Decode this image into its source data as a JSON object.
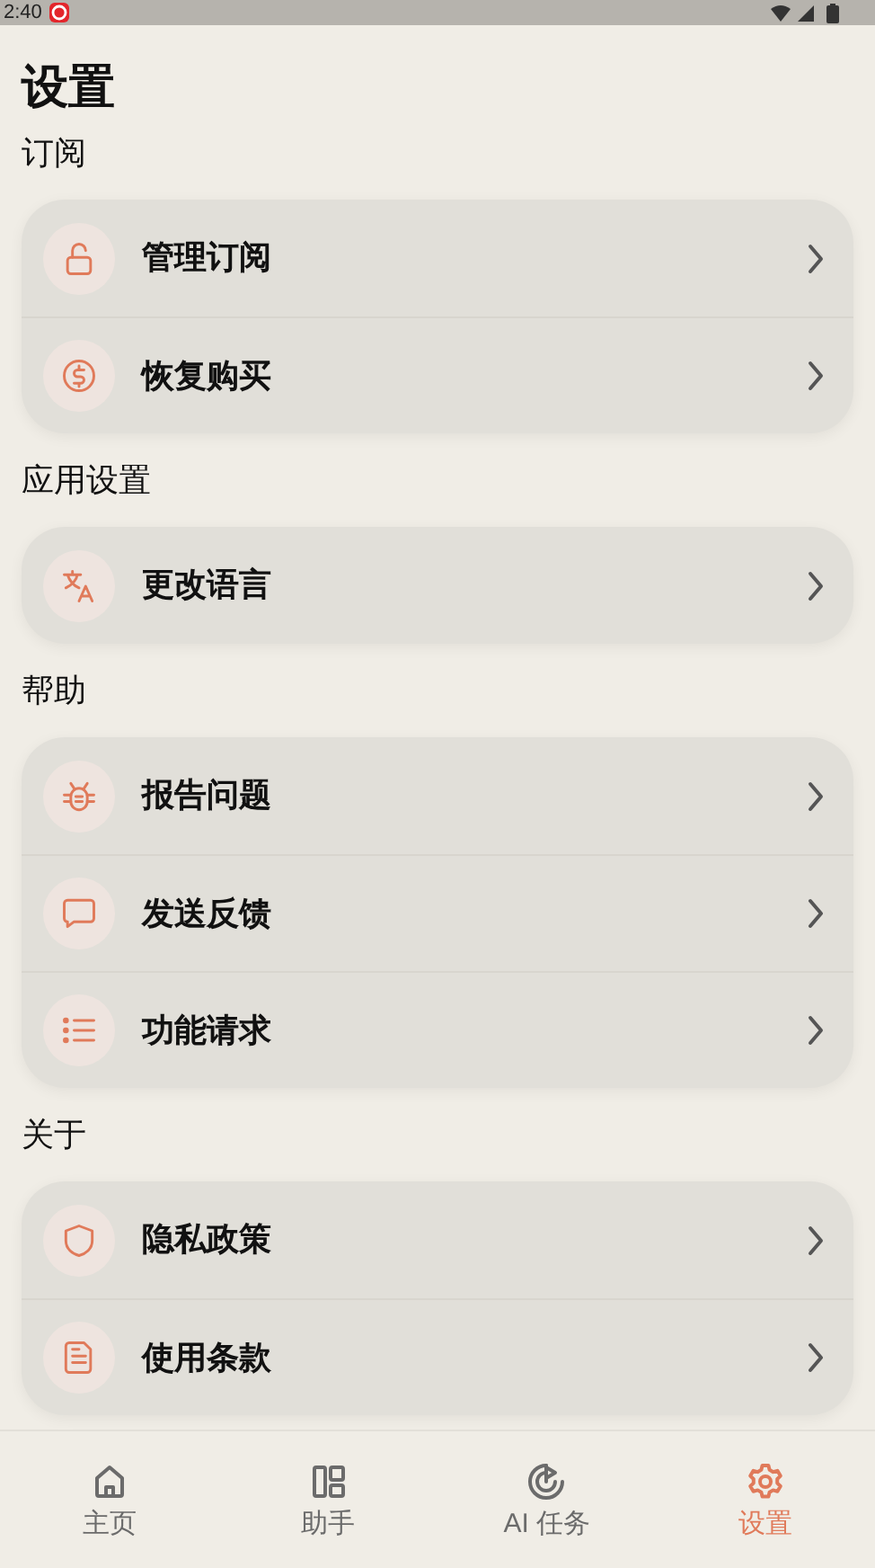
{
  "status_bar": {
    "time": "2:40"
  },
  "title": "设置",
  "sections": [
    {
      "title": "订阅",
      "items": [
        {
          "kind": "lock",
          "label": "管理订阅"
        },
        {
          "kind": "dollar",
          "label": "恢复购买"
        }
      ]
    },
    {
      "title": "应用设置",
      "items": [
        {
          "kind": "translate",
          "label": "更改语言"
        }
      ]
    },
    {
      "title": "帮助",
      "items": [
        {
          "kind": "bug",
          "label": "报告问题"
        },
        {
          "kind": "chat",
          "label": "发送反馈"
        },
        {
          "kind": "list",
          "label": "功能请求"
        }
      ]
    },
    {
      "title": "关于",
      "items": [
        {
          "kind": "shield",
          "label": "隐私政策"
        },
        {
          "kind": "document",
          "label": "使用条款"
        }
      ]
    }
  ],
  "bottom_nav": [
    {
      "kind": "home",
      "label": "主页",
      "selected": false
    },
    {
      "kind": "panels",
      "label": "助手",
      "selected": false
    },
    {
      "kind": "target",
      "label": "AI 任务",
      "selected": false
    },
    {
      "kind": "gear",
      "label": "设置",
      "selected": true
    }
  ]
}
